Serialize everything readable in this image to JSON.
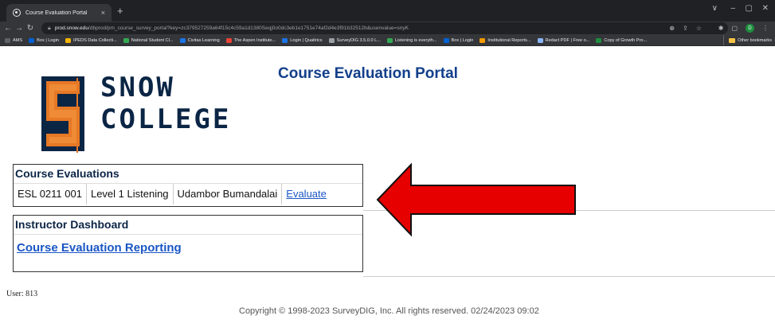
{
  "browser": {
    "tab_title": "Course Evaluation Portal",
    "tab_close": "×",
    "new_tab": "+",
    "url_host": "prod.snow.edu",
    "url_path": "/dbprod/pm_course_survey_portal?key=zc379527259a64f15c4c59a1d1380Seqj0o0dc3eb1e1751e74af2d4e3f91b32512b&usenvalue=snyK",
    "window_controls": [
      "∨",
      "–",
      "▢",
      "✕"
    ],
    "profile_letter": "D"
  },
  "bookmarks": [
    {
      "label": "AMS",
      "color": "#5f6368"
    },
    {
      "label": "Box | Login",
      "color": "#0061d5"
    },
    {
      "label": "IPEDS Data Collecti...",
      "color": "#f4b400"
    },
    {
      "label": "National Student Cl...",
      "color": "#34a853"
    },
    {
      "label": "Civitas Learning",
      "color": "#1a73e8"
    },
    {
      "label": "The Aspen Institute...",
      "color": "#ea4335"
    },
    {
      "label": "Login | Qualtrics",
      "color": "#1a73e8"
    },
    {
      "label": "SurveyDIG 3.5.0.0 L...",
      "color": "#9aa0a6"
    },
    {
      "label": "Listening is everyth...",
      "color": "#34a853"
    },
    {
      "label": "Box | Login",
      "color": "#0061d5"
    },
    {
      "label": "Institutional Reports...",
      "color": "#f29900"
    },
    {
      "label": "Redact PDF | Free o...",
      "color": "#8ab4f8"
    },
    {
      "label": "Copy of Growth Pro...",
      "color": "#1e8e3e"
    }
  ],
  "other_bookmarks": "Other bookmarks",
  "logo": {
    "line1": "SNOW",
    "line2": "COLLEGE",
    "orange": "#e77825",
    "navy": "#0b2545"
  },
  "portal_title": "Course Evaluation Portal",
  "course_evaluations": {
    "heading": "Course Evaluations",
    "rows": [
      {
        "course": "ESL 0211 001",
        "title": "Level 1 Listening",
        "instructor": "Udambor Bumandalai",
        "action": "Evaluate"
      }
    ]
  },
  "instructor_dashboard": {
    "heading": "Instructor Dashboard",
    "link": "Course Evaluation Reporting"
  },
  "user_line": "User: 813",
  "copyright": "Copyright © 1998-2023 SurveyDIG, Inc. All rights reserved. 02/24/2023 09:02",
  "arrow_color": "#e60000"
}
